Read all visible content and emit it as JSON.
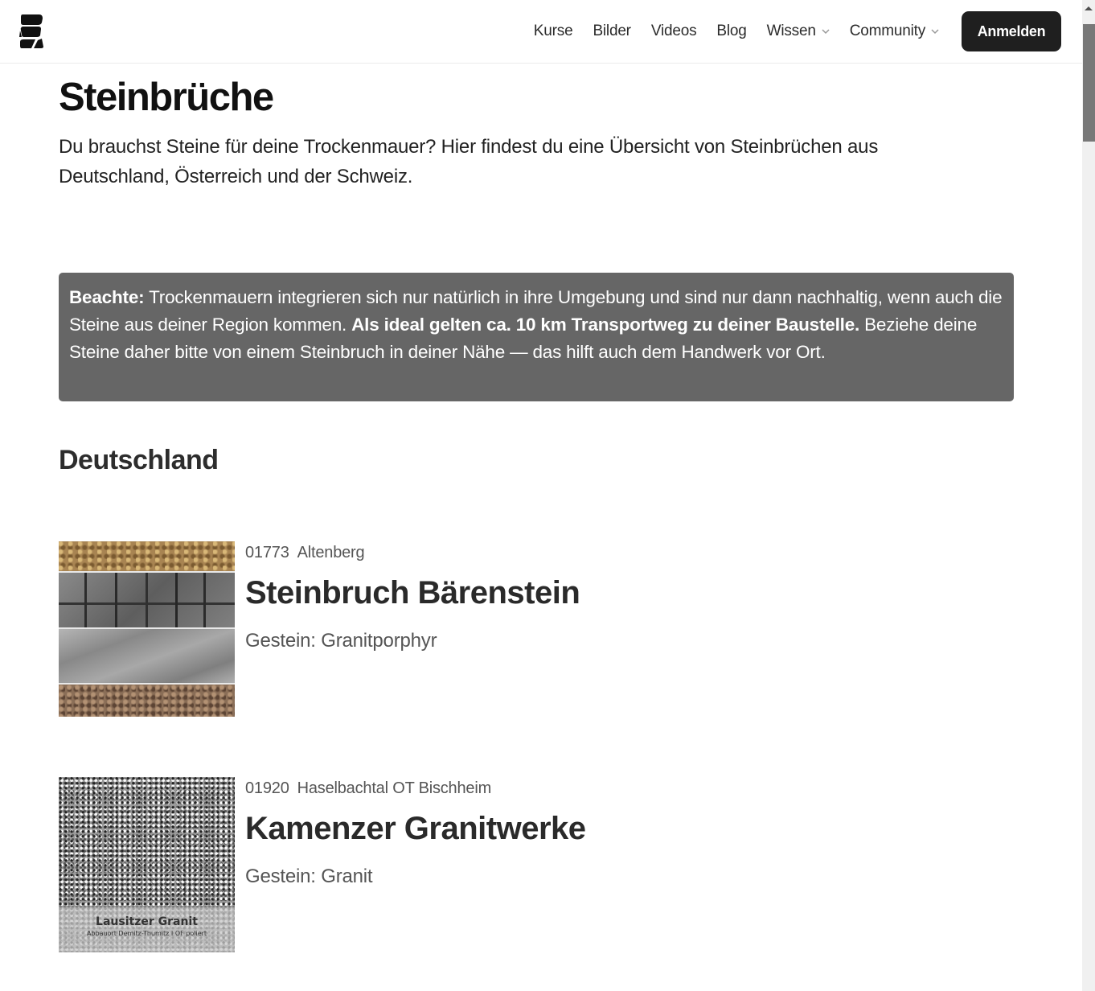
{
  "header": {
    "logo_icon": "stacked-stones-logo-icon",
    "nav": [
      {
        "label": "Kurse",
        "has_dropdown": false
      },
      {
        "label": "Bilder",
        "has_dropdown": false
      },
      {
        "label": "Videos",
        "has_dropdown": false
      },
      {
        "label": "Blog",
        "has_dropdown": false
      },
      {
        "label": "Wissen",
        "has_dropdown": true
      },
      {
        "label": "Community",
        "has_dropdown": true
      }
    ],
    "login_label": "Anmelden"
  },
  "page": {
    "title": "Steinbrüche",
    "intro": "Du brauchst Steine für deine Trockenmauer? Hier findest du eine Übersicht von Steinbrüchen aus Deutschland, Österreich und der Schweiz."
  },
  "notice": {
    "lead_bold": "Beachte:",
    "text_1": " Trockenmauern integrieren sich nur natürlich in ihre Umgebung und sind nur dann nachhaltig, wenn auch die Steine aus deiner Region kommen. ",
    "mid_bold": "Als ideal gelten ca. 10 km Transportweg zu deiner Baustelle.",
    "text_2": " Beziehe deine Steine daher bitte von einem Steinbruch in deiner Nähe — das hilft auch dem Handwerk vor Ort.",
    "background_color": "#666666"
  },
  "sections": [
    {
      "title": "Deutschland",
      "entries": [
        {
          "postal_code": "01773",
          "city": "Altenberg",
          "name": "Steinbruch Bärenstein",
          "rock": "Gestein: Granitporphyr",
          "image": "stone-strips-collage"
        },
        {
          "postal_code": "01920",
          "city": "Haselbachtal OT Bischheim",
          "name": "Kamenzer Granitwerke",
          "rock": "Gestein: Granit",
          "image": "granite-sample",
          "image_caption_title": "Lausitzer Granit",
          "image_caption_sub": "Abbauort Demitz-Thumitz I OF poliert"
        }
      ]
    }
  ],
  "colors": {
    "button_bg": "#1f1f1f",
    "text_primary": "#1f1f1f",
    "text_secondary": "#555555"
  }
}
